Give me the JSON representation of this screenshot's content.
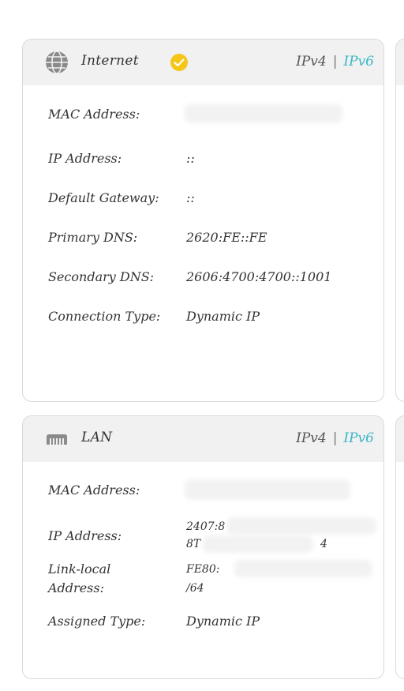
{
  "internet": {
    "title": "Internet",
    "ipv4": "IPv4",
    "separator": "|",
    "ipv6": "IPv6",
    "rows": [
      {
        "label": "MAC Address:",
        "value": ""
      },
      {
        "label": "IP Address:",
        "value": "::"
      },
      {
        "label": "Default Gateway:",
        "value": "::"
      },
      {
        "label": "Primary DNS:",
        "value": "2620:FE::FE"
      },
      {
        "label": "Secondary DNS:",
        "value": "2606:4700:4700::1001"
      },
      {
        "label": "Connection Type:",
        "value": "Dynamic IP"
      }
    ]
  },
  "lan": {
    "title": "LAN",
    "ipv4": "IPv4",
    "separator": "|",
    "ipv6": "IPv6",
    "rows": [
      {
        "label": "MAC Address:",
        "value": ""
      },
      {
        "label": "IP Address:",
        "value_line1": "2407:8",
        "value_line2": "8T",
        "value_suffix": "4"
      },
      {
        "label_line1": "Link-local",
        "label_line2": "Address:",
        "value_line1": "FE80:",
        "value_line2": "/64"
      },
      {
        "label": "Assigned Type:",
        "value": "Dynamic IP"
      }
    ]
  },
  "colors": {
    "accent": "#3bb6c8",
    "check": "#f5c518",
    "header_bg": "#f1f1f1"
  }
}
